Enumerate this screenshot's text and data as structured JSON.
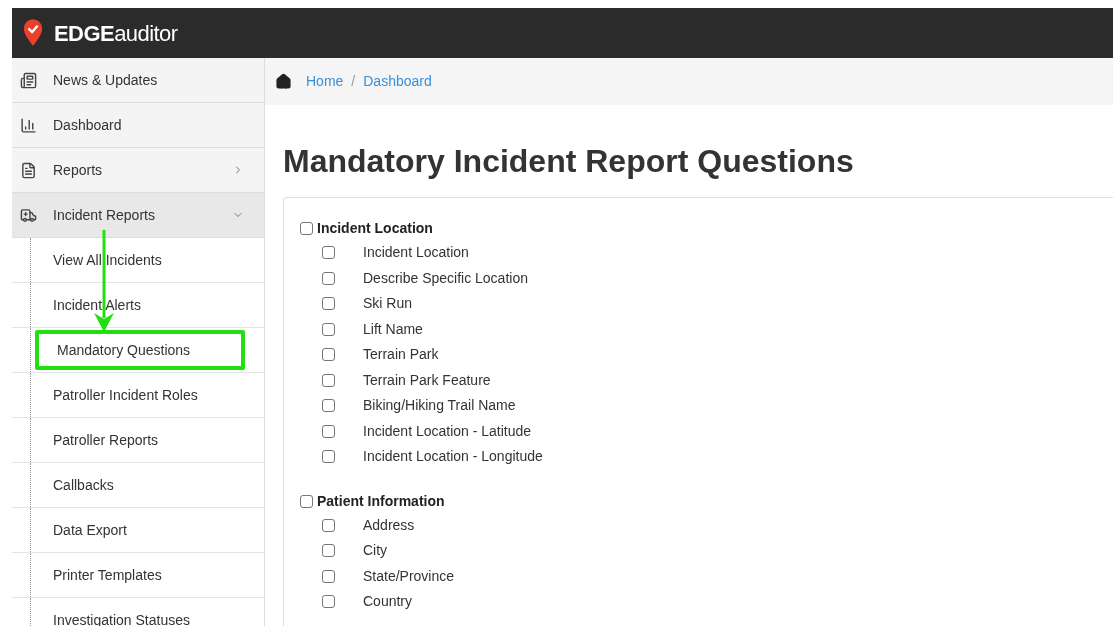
{
  "brand": {
    "bold": "EDGE",
    "rest": "auditor"
  },
  "sidebar": {
    "items": [
      {
        "label": "News & Updates"
      },
      {
        "label": "Dashboard"
      },
      {
        "label": "Reports",
        "expanded": false
      },
      {
        "label": "Incident Reports",
        "expanded": true,
        "children": [
          {
            "label": "View All Incidents",
            "highlighted": false
          },
          {
            "label": "Incident Alerts",
            "highlighted": false
          },
          {
            "label": "Mandatory Questions",
            "highlighted": true
          },
          {
            "label": "Patroller Incident Roles",
            "highlighted": false
          },
          {
            "label": "Patroller Reports",
            "highlighted": false
          },
          {
            "label": "Callbacks",
            "highlighted": false
          },
          {
            "label": "Data Export",
            "highlighted": false
          },
          {
            "label": "Printer Templates",
            "highlighted": false
          },
          {
            "label": "Investigation Statuses",
            "highlighted": false
          }
        ]
      }
    ]
  },
  "breadcrumb": [
    "Home",
    "Dashboard"
  ],
  "breadcrumb_separator": "/",
  "title": "Mandatory Incident Report Questions",
  "groups": [
    {
      "label": "Incident Location",
      "checked": false,
      "questions": [
        {
          "label": "Incident Location",
          "checked": false
        },
        {
          "label": "Describe Specific Location",
          "checked": false
        },
        {
          "label": "Ski Run",
          "checked": false
        },
        {
          "label": "Lift Name",
          "checked": false
        },
        {
          "label": "Terrain Park",
          "checked": false
        },
        {
          "label": "Terrain Park Feature",
          "checked": false
        },
        {
          "label": "Biking/Hiking Trail Name",
          "checked": false
        },
        {
          "label": "Incident Location - Latitude",
          "checked": false
        },
        {
          "label": "Incident Location - Longitude",
          "checked": false
        }
      ]
    },
    {
      "label": "Patient Information",
      "checked": false,
      "questions": [
        {
          "label": "Address",
          "checked": false
        },
        {
          "label": "City",
          "checked": false
        },
        {
          "label": "State/Province",
          "checked": false
        },
        {
          "label": "Country",
          "checked": false
        }
      ]
    }
  ]
}
